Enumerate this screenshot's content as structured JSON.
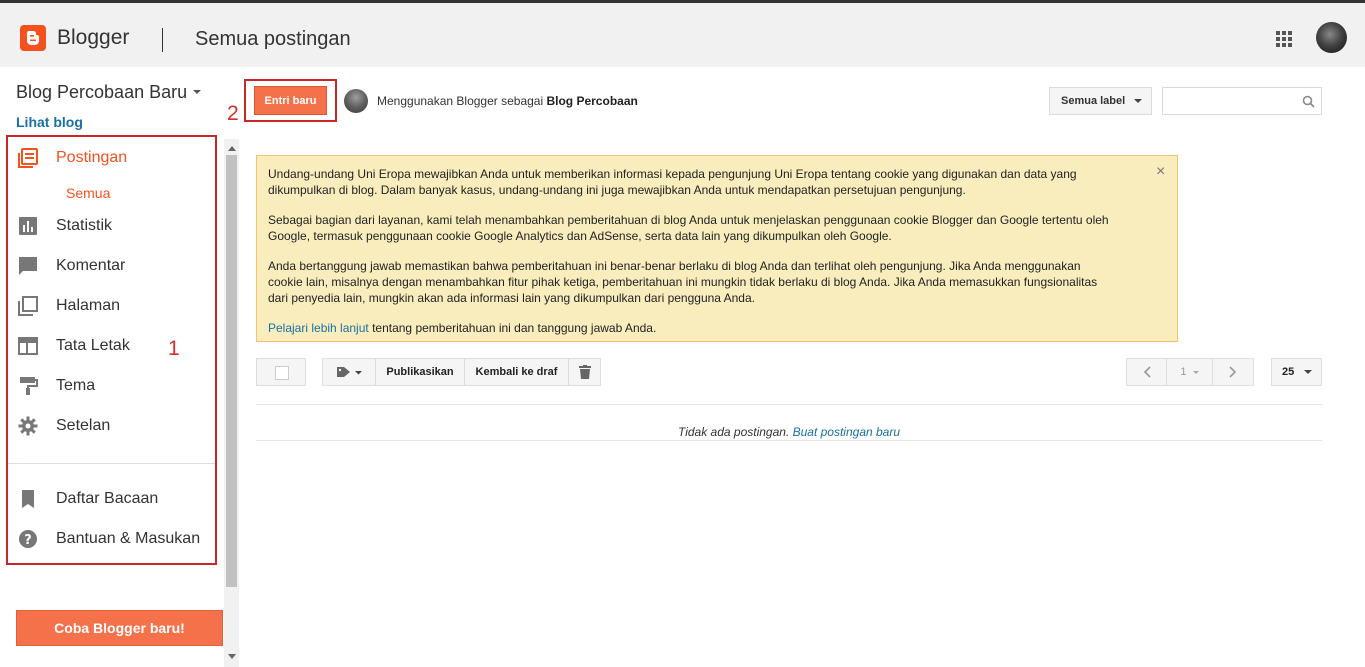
{
  "header": {
    "brand": "Blogger",
    "page_title": "Semua postingan"
  },
  "sidebar": {
    "blog_name": "Blog Percobaan Baru",
    "view_blog": "Lihat blog",
    "items": [
      {
        "label": "Postingan",
        "icon": "posts-icon"
      },
      {
        "label": "Statistik",
        "icon": "stats-icon"
      },
      {
        "label": "Komentar",
        "icon": "comment-icon"
      },
      {
        "label": "Halaman",
        "icon": "pages-icon"
      },
      {
        "label": "Tata Letak",
        "icon": "layout-icon"
      },
      {
        "label": "Tema",
        "icon": "paint-roller-icon"
      },
      {
        "label": "Setelan",
        "icon": "gear-icon"
      },
      {
        "label": "Daftar Bacaan",
        "icon": "bookmark-icon"
      },
      {
        "label": "Bantuan & Masukan",
        "icon": "help-icon"
      }
    ],
    "sub_item": "Semua",
    "try_button": "Coba Blogger baru!"
  },
  "annotations": {
    "marker_1": "1",
    "marker_2": "2"
  },
  "toolbar": {
    "new_post": "Entri baru",
    "using_prefix": "Menggunakan Blogger sebagai",
    "using_name": "Blog Percobaan",
    "label_filter": "Semua label",
    "search_placeholder": ""
  },
  "notice": {
    "p1": "Undang-undang Uni Eropa mewajibkan Anda untuk memberikan informasi kepada pengunjung Uni Eropa tentang cookie yang digunakan dan data yang dikumpulkan di blog. Dalam banyak kasus, undang-undang ini juga mewajibkan Anda untuk mendapatkan persetujuan pengunjung.",
    "p2": "Sebagai bagian dari layanan, kami telah menambahkan pemberitahuan di blog Anda untuk menjelaskan penggunaan cookie Blogger dan Google tertentu oleh Google, termasuk penggunaan cookie Google Analytics dan AdSense, serta data lain yang dikumpulkan oleh Google.",
    "p3": "Anda bertanggung jawab memastikan bahwa pemberitahuan ini benar-benar berlaku di blog Anda dan terlihat oleh pengunjung. Jika Anda menggunakan cookie lain, misalnya dengan menambahkan fitur pihak ketiga, pemberitahuan ini mungkin tidak berlaku di blog Anda. Jika Anda memasukkan fungsionalitas dari penyedia lain, mungkin akan ada informasi lain yang dikumpulkan dari pengguna Anda.",
    "link": "Pelajari lebih lanjut",
    "link_suffix": " tentang pemberitahuan ini dan tanggung jawab Anda.",
    "close": "×"
  },
  "actions": {
    "publish": "Publikasikan",
    "revert": "Kembali ke draf",
    "page": "1",
    "per_page": "25"
  },
  "posts": {
    "empty_text": "Tidak ada postingan. ",
    "empty_link": "Buat postingan baru"
  },
  "colors": {
    "accent": "#f4511e",
    "link": "#1a6fa3",
    "notice_bg": "#f9edbe",
    "annotation": "#c62828"
  }
}
